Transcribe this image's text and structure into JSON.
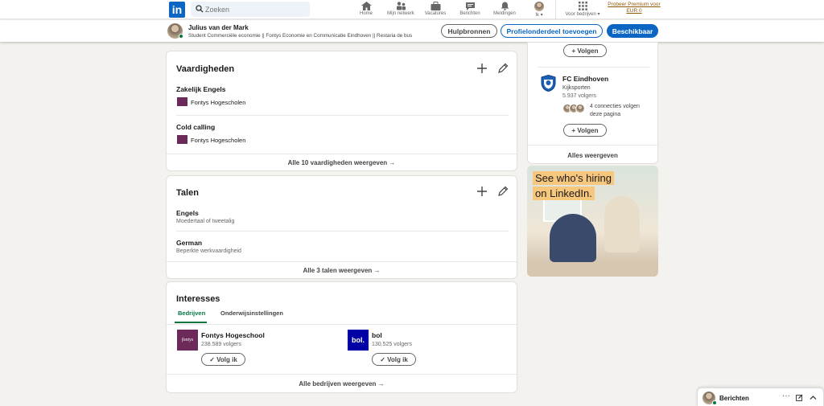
{
  "nav": {
    "search_placeholder": "Zoeken",
    "items": [
      {
        "label": "Home",
        "icon": "home-icon"
      },
      {
        "label": "Mijn netwerk",
        "icon": "network-icon"
      },
      {
        "label": "Vacatures",
        "icon": "briefcase-icon"
      },
      {
        "label": "Berichten",
        "icon": "messaging-icon"
      },
      {
        "label": "Meldingen",
        "icon": "bell-icon"
      },
      {
        "label": "Ik",
        "icon": "avatar"
      },
      {
        "label": "Voor bedrijven",
        "icon": "grid-icon"
      }
    ],
    "premium": "Probeer Premium voor EUR 0"
  },
  "profile_bar": {
    "name": "Julius van der Mark",
    "headline": "Student Commerciële economie || Fontys Economie en Communicatie Eindhoven || Restaria de bus",
    "btn_resources": "Hulpbronnen",
    "btn_add_section": "Profielonderdeel toevoegen",
    "btn_available": "Beschikbaar"
  },
  "skills": {
    "title": "Vaardigheden",
    "items": [
      {
        "name": "Zakelijk Engels",
        "org": "Fontys Hogescholen"
      },
      {
        "name": "Cold calling",
        "org": "Fontys Hogescholen"
      }
    ],
    "footer": "Alle 10 vaardigheden weergeven →"
  },
  "languages": {
    "title": "Talen",
    "items": [
      {
        "name": "Engels",
        "level": "Moedertaal of tweetalig"
      },
      {
        "name": "German",
        "level": "Beperkte werkvaardigheid"
      }
    ],
    "footer": "Alle 3 talen weergeven →"
  },
  "interests": {
    "title": "Interesses",
    "tabs": [
      "Bedrijven",
      "Onderwijsinstellingen"
    ],
    "companies": [
      {
        "name": "Fontys Hogeschool",
        "followers": "238.589 volgers",
        "button": "Volg ik",
        "logo_text": "fontys"
      },
      {
        "name": "bol",
        "followers": "130.525 volgers",
        "button": "Volg ik",
        "logo_text": "bol."
      }
    ],
    "footer": "Alle bedrijven weergeven →"
  },
  "sidebar": {
    "follow_top": "Volgen",
    "page": {
      "name": "FC Eindhoven",
      "category": "Kijksporten",
      "followers": "5.937 volgers",
      "connections": "4 connecties volgen deze pagina",
      "follow": "Volgen"
    },
    "show_all": "Alles weergeven"
  },
  "ad": {
    "line1": "See who's hiring",
    "line2": "on LinkedIn."
  },
  "messaging": {
    "label": "Berichten"
  },
  "colors": {
    "brand": "#0a66c2",
    "accent_green": "#057642",
    "premium": "#915907"
  }
}
